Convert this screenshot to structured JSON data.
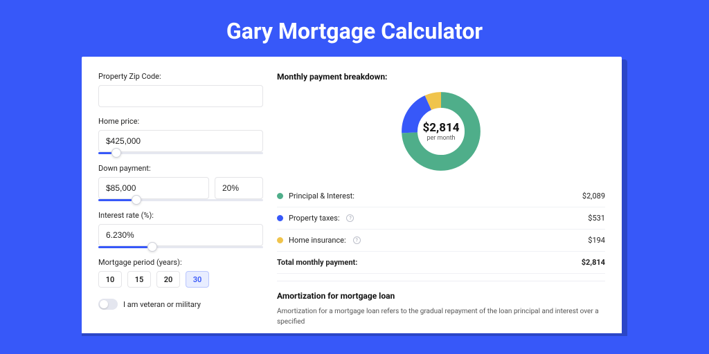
{
  "title": "Gary Mortgage Calculator",
  "form": {
    "zip": {
      "label": "Property Zip Code:",
      "value": ""
    },
    "home_price": {
      "label": "Home price:",
      "value": "$425,000",
      "slider_pct": 8
    },
    "down_payment": {
      "label": "Down payment:",
      "value": "$85,000",
      "pct_value": "20%",
      "slider_pct": 20
    },
    "interest_rate": {
      "label": "Interest rate (%):",
      "value": "6.230%",
      "slider_pct": 30
    },
    "period": {
      "label": "Mortgage period (years):",
      "options": [
        "10",
        "15",
        "20",
        "30"
      ],
      "selected": "30"
    },
    "veteran": {
      "label": "I am veteran or military",
      "checked": false
    }
  },
  "breakdown": {
    "title": "Monthly payment breakdown:",
    "center_amount": "$2,814",
    "center_sub": "per month",
    "items": [
      {
        "label": "Principal & Interest:",
        "value": "$2,089",
        "color": "#4fae8a",
        "help": false
      },
      {
        "label": "Property taxes:",
        "value": "$531",
        "color": "#3758f9",
        "help": true
      },
      {
        "label": "Home insurance:",
        "value": "$194",
        "color": "#f0c44c",
        "help": true
      }
    ],
    "total_label": "Total monthly payment:",
    "total_value": "$2,814"
  },
  "amortization": {
    "title": "Amortization for mortgage loan",
    "body": "Amortization for a mortgage loan refers to the gradual repayment of the loan principal and interest over a specified"
  },
  "chart_data": {
    "type": "pie",
    "title": "Monthly payment breakdown",
    "series": [
      {
        "name": "Principal & Interest",
        "value": 2089,
        "color": "#4fae8a"
      },
      {
        "name": "Property taxes",
        "value": 531,
        "color": "#3758f9"
      },
      {
        "name": "Home insurance",
        "value": 194,
        "color": "#f0c44c"
      }
    ],
    "total": 2814,
    "center_label": "$2,814 per month"
  }
}
